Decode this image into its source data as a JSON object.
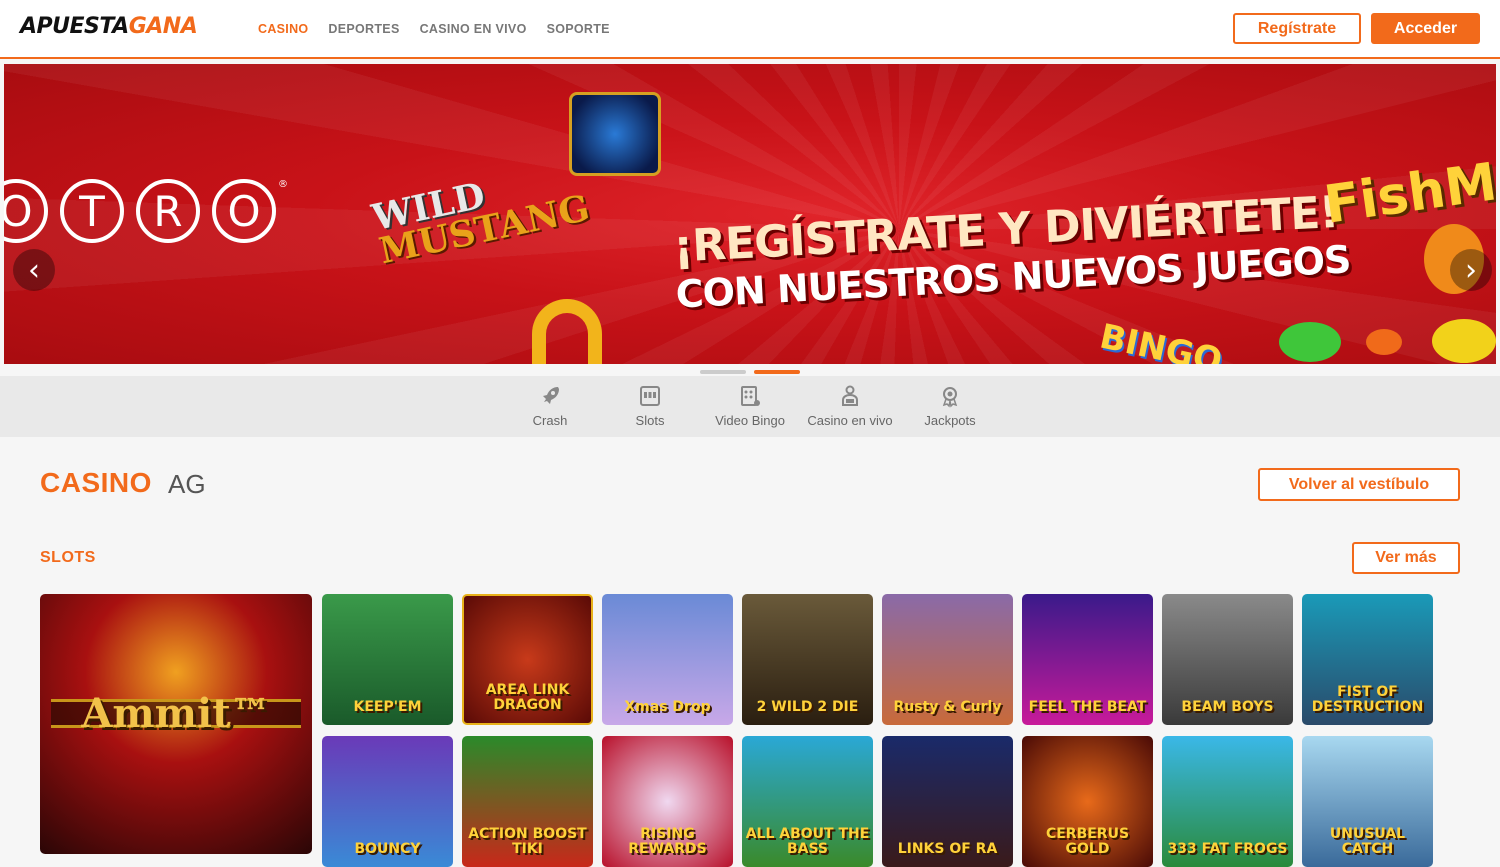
{
  "header": {
    "logo_part1": "APUESTA",
    "logo_part2": "GANA",
    "nav": [
      "CASINO",
      "DEPORTES",
      "CASINO EN VIVO",
      "SOPORTE"
    ],
    "register_label": "Regístrate",
    "login_label": "Acceder"
  },
  "banner": {
    "brand_letters": [
      "O",
      "T",
      "R",
      "O"
    ],
    "brand_reg": "®",
    "headline_line1": "¡REGÍSTRATE Y DIVIÉRTETE!",
    "headline_line2": "CON NUESTROS NUEVOS JUEGOS",
    "wild_line1": "WILD",
    "wild_line2": "MUSTANG",
    "bingo_text": "BINGO",
    "fish_text": "FishM",
    "prev_arrow": "‹",
    "next_arrow": "›",
    "slide_count": 2,
    "active_slide": 2
  },
  "categories": [
    "Crash",
    "Slots",
    "Video Bingo",
    "Casino en vivo",
    "Jackpots"
  ],
  "section": {
    "title": "CASINO",
    "subtitle": "AG",
    "back_label": "Volver al vestíbulo",
    "slots_label": "SLOTS",
    "more_label": "Ver más"
  },
  "games": {
    "featured": "Ammit™",
    "row1": [
      "KEEP'EM",
      "AREA LINK DRAGON",
      "Xmas Drop",
      "2 WILD 2 DIE",
      "Rusty & Curly",
      "FEEL THE BEAT",
      "BEAM BOYS",
      "FIST OF DESTRUCTION"
    ],
    "row2": [
      "BOUNCY",
      "ACTION BOOST TIKI",
      "RISING REWARDS",
      "ALL ABOUT THE BASS",
      "LINKS OF RA",
      "CERBERUS GOLD",
      "333 FAT FROGS",
      "UNUSUAL CATCH"
    ]
  },
  "colors": {
    "accent": "#f26a1b",
    "banner_red": "#c81218",
    "category_bar": "#e9e9e9"
  }
}
